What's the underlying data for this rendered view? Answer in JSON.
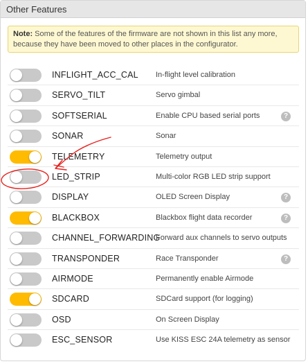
{
  "panel": {
    "title": "Other Features",
    "note_bold": "Note:",
    "note_text": " Some of the features of the firmware are not shown in this list any more, because they have been moved to other places in the configurator."
  },
  "features": [
    {
      "name": "INFLIGHT_ACC_CAL",
      "description": "In-flight level calibration",
      "enabled": false,
      "help": false
    },
    {
      "name": "SERVO_TILT",
      "description": "Servo gimbal",
      "enabled": false,
      "help": false
    },
    {
      "name": "SOFTSERIAL",
      "description": "Enable CPU based serial ports",
      "enabled": false,
      "help": true
    },
    {
      "name": "SONAR",
      "description": "Sonar",
      "enabled": false,
      "help": false
    },
    {
      "name": "TELEMETRY",
      "description": "Telemetry output",
      "enabled": true,
      "help": false
    },
    {
      "name": "LED_STRIP",
      "description": "Multi-color RGB LED strip support",
      "enabled": false,
      "help": false
    },
    {
      "name": "DISPLAY",
      "description": "OLED Screen Display",
      "enabled": false,
      "help": true
    },
    {
      "name": "BLACKBOX",
      "description": "Blackbox flight data recorder",
      "enabled": true,
      "help": true
    },
    {
      "name": "CHANNEL_FORWARDING",
      "description": "Forward aux channels to servo outputs",
      "enabled": false,
      "help": false
    },
    {
      "name": "TRANSPONDER",
      "description": "Race Transponder",
      "enabled": false,
      "help": true
    },
    {
      "name": "AIRMODE",
      "description": "Permanently enable Airmode",
      "enabled": false,
      "help": false
    },
    {
      "name": "SDCARD",
      "description": "SDCard support (for logging)",
      "enabled": true,
      "help": false
    },
    {
      "name": "OSD",
      "description": "On Screen Display",
      "enabled": false,
      "help": false
    },
    {
      "name": "ESC_SENSOR",
      "description": "Use KISS ESC 24A telemetry as sensor",
      "enabled": false,
      "help": false
    }
  ],
  "help_icon_glyph": "?",
  "colors": {
    "toggle_on": "#ffbb00",
    "toggle_off": "#c9c9c9",
    "note_bg": "#fef8d2",
    "annotation": "#e8201c"
  }
}
